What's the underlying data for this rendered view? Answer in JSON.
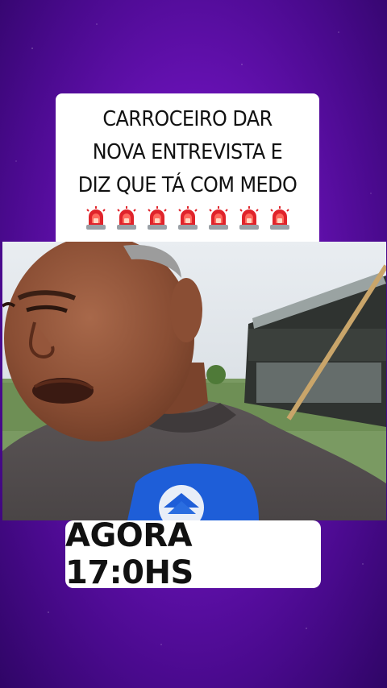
{
  "headline": {
    "lines": [
      "CARROCEIRO DAR",
      "NOVA ENTREVISTA E",
      "DIZ QUE TÁ COM MEDO"
    ],
    "siren_icon": "police-siren-emoji"
  },
  "time_banner": {
    "text": "AGORA 17:0HS"
  },
  "colors": {
    "background": "#6a12b8",
    "card": "#ffffff",
    "text": "#111111",
    "mic_flag": "#1e5ed8"
  }
}
